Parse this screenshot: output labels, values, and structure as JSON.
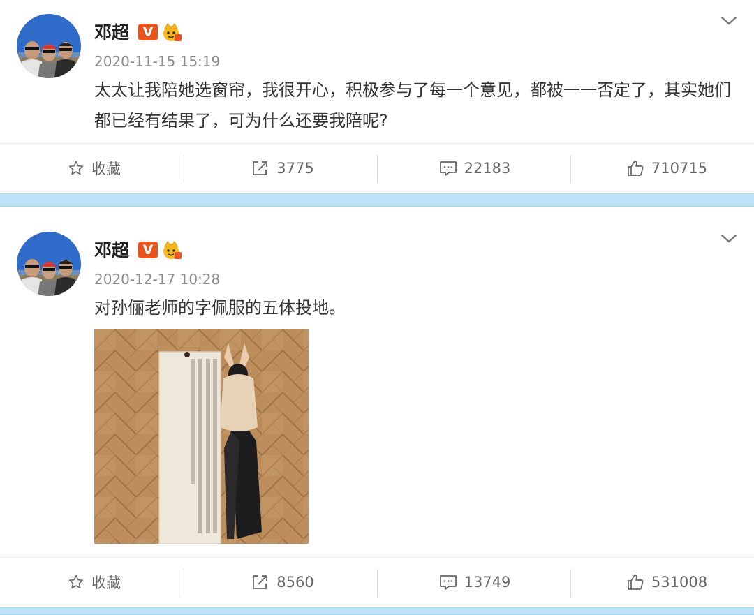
{
  "posts": [
    {
      "author": "邓超",
      "verified_badge": "V",
      "timestamp": "2020-11-15 15:19",
      "text": "太太让我陪她选窗帘，我很开心，积极参与了每一个意见，都被一一否定了，其实她们都已经有结果了，可为什么还要我陪呢?",
      "actions": {
        "favorite": "收藏",
        "repost": "3775",
        "comment": "22183",
        "like": "710715"
      }
    },
    {
      "author": "邓超",
      "verified_badge": "V",
      "timestamp": "2020-12-17 10:28",
      "text": "对孙俪老师的字佩服的五体投地。",
      "actions": {
        "favorite": "收藏",
        "repost": "8560",
        "comment": "13749",
        "like": "531008"
      }
    }
  ],
  "icons": {
    "favorite": "star-icon",
    "repost": "repost-icon",
    "comment": "comment-icon",
    "like": "thumbs-up-icon",
    "menu": "chevron-down-icon",
    "badge_crown": "crown-badge-icon"
  },
  "colors": {
    "separator": "#bfe3f6",
    "verified": "#e8541e",
    "text": "#333333",
    "meta": "#8a8a8a"
  }
}
